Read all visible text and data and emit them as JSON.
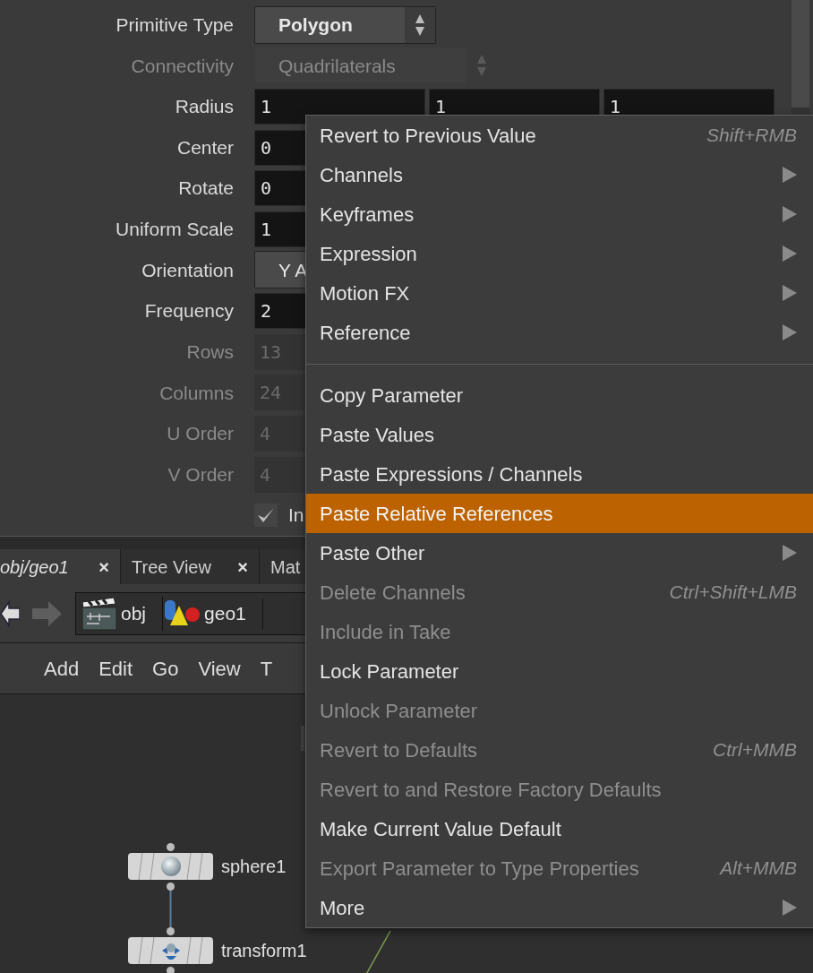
{
  "parameters": [
    {
      "kind": "menu",
      "label": "Primitive Type",
      "value": "Polygon",
      "disabled": false
    },
    {
      "kind": "menu",
      "label": "Connectivity",
      "value": "Quadrilaterals",
      "disabled": true
    },
    {
      "kind": "vector",
      "label": "Radius",
      "values": [
        "1",
        "1",
        "1"
      ],
      "disabled": false
    },
    {
      "kind": "vector",
      "label": "Center",
      "values": [
        "0"
      ],
      "disabled": false
    },
    {
      "kind": "vector",
      "label": "Rotate",
      "values": [
        "0"
      ],
      "disabled": false
    },
    {
      "kind": "vector",
      "label": "Uniform Scale",
      "values": [
        "1"
      ],
      "disabled": false
    },
    {
      "kind": "button",
      "label": "Orientation",
      "value": "Y A",
      "disabled": false
    },
    {
      "kind": "vector",
      "label": "Frequency",
      "values": [
        "2"
      ],
      "disabled": false
    },
    {
      "kind": "vector",
      "label": "Rows",
      "values": [
        "13"
      ],
      "disabled": true
    },
    {
      "kind": "vector",
      "label": "Columns",
      "values": [
        "24"
      ],
      "disabled": true
    },
    {
      "kind": "vector",
      "label": "U Order",
      "values": [
        "4"
      ],
      "disabled": true
    },
    {
      "kind": "vector",
      "label": "V Order",
      "values": [
        "4"
      ],
      "disabled": true
    },
    {
      "kind": "checkbox",
      "label": "In",
      "checked": true,
      "disabled": false
    }
  ],
  "tabs": [
    {
      "label": "obj/geo1",
      "close": "×",
      "selected": true
    },
    {
      "label": "Tree View",
      "close": "×",
      "selected": false
    },
    {
      "label": "Mat",
      "selected": false
    }
  ],
  "path": [
    "obj",
    "geo1"
  ],
  "menubar": [
    "Add",
    "Edit",
    "Go",
    "View",
    "T"
  ],
  "nodes": [
    {
      "label": "sphere1"
    },
    {
      "label": "transform1"
    }
  ],
  "context_menu": [
    {
      "kind": "item",
      "label": "Revert to Previous Value",
      "shortcut": "Shift+RMB",
      "submenu": false,
      "disabled": false,
      "selected": false
    },
    {
      "kind": "item",
      "label": "Channels",
      "submenu": true,
      "disabled": false,
      "selected": false
    },
    {
      "kind": "item",
      "label": "Keyframes",
      "submenu": true,
      "disabled": false,
      "selected": false
    },
    {
      "kind": "item",
      "label": "Expression",
      "submenu": true,
      "disabled": false,
      "selected": false
    },
    {
      "kind": "item",
      "label": "Motion FX",
      "submenu": true,
      "disabled": false,
      "selected": false
    },
    {
      "kind": "item",
      "label": "Reference",
      "submenu": true,
      "disabled": false,
      "selected": false
    },
    {
      "kind": "separator"
    },
    {
      "kind": "item",
      "label": "Copy Parameter",
      "submenu": false,
      "disabled": false,
      "selected": false
    },
    {
      "kind": "item",
      "label": "Paste Values",
      "submenu": false,
      "disabled": false,
      "selected": false
    },
    {
      "kind": "item",
      "label": "Paste Expressions / Channels",
      "submenu": false,
      "disabled": false,
      "selected": false
    },
    {
      "kind": "item",
      "label": "Paste Relative References",
      "submenu": false,
      "disabled": false,
      "selected": true
    },
    {
      "kind": "item",
      "label": "Paste Other",
      "submenu": true,
      "disabled": false,
      "selected": false
    },
    {
      "kind": "item",
      "label": "Delete Channels",
      "shortcut": "Ctrl+Shift+LMB",
      "submenu": false,
      "disabled": true,
      "selected": false
    },
    {
      "kind": "item",
      "label": "Include in Take",
      "submenu": false,
      "disabled": true,
      "selected": false
    },
    {
      "kind": "item",
      "label": "Lock Parameter",
      "submenu": false,
      "disabled": false,
      "selected": false
    },
    {
      "kind": "item",
      "label": "Unlock Parameter",
      "submenu": false,
      "disabled": true,
      "selected": false
    },
    {
      "kind": "item",
      "label": "Revert to Defaults",
      "shortcut": "Ctrl+MMB",
      "submenu": false,
      "disabled": true,
      "selected": false
    },
    {
      "kind": "item",
      "label": "Revert to and Restore Factory Defaults",
      "submenu": false,
      "disabled": true,
      "selected": false
    },
    {
      "kind": "item",
      "label": "Make Current Value Default",
      "submenu": false,
      "disabled": false,
      "selected": false
    },
    {
      "kind": "item",
      "label": "Export Parameter to Type Properties",
      "shortcut": "Alt+MMB",
      "submenu": false,
      "disabled": true,
      "selected": false
    },
    {
      "kind": "item",
      "label": "More",
      "submenu": true,
      "disabled": false,
      "selected": false
    }
  ]
}
